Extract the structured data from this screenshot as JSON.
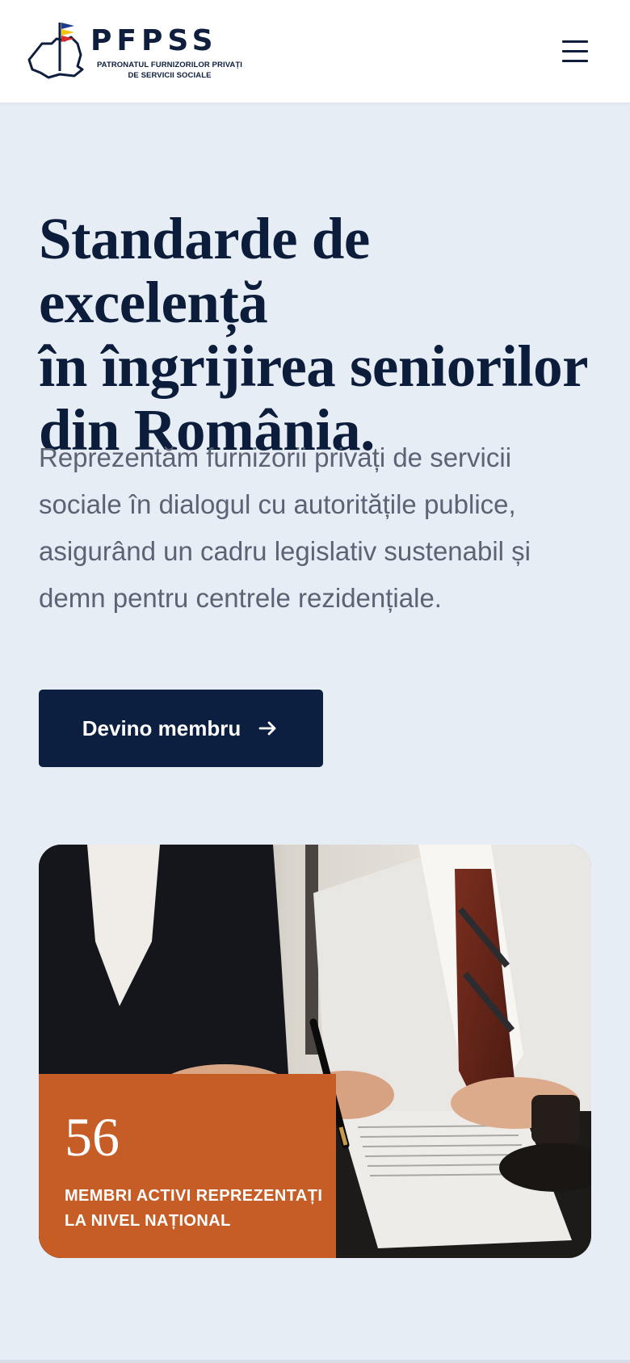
{
  "header": {
    "logo_name": "PFPSS",
    "logo_subtitle": "PATRONATUL FURNIZORILOR PRIVAȚI\nDE SERVICII SOCIALE",
    "menu_icon": "hamburger-menu-icon"
  },
  "hero": {
    "title": "Standarde de excelență\nîn îngrijirea seniorilor\ndin România.",
    "lead": "Reprezentăm furnizorii privați de servicii\nsociale în dialogul cu autoritățile publice,\nasigurând un cadru legislativ sustenabil și\ndemn pentru centrele rezidențiale.",
    "cta_label": "Devino membru",
    "cta_icon": "arrow-right-icon"
  },
  "stats": {
    "number": "56",
    "label": "MEMBRI ACTIVI REPREZENTAȚI\nLA NIVEL NAȚIONAL"
  },
  "colors": {
    "navy": "#0c1f40",
    "accent": "#c65c26",
    "background": "#e7edf5"
  }
}
